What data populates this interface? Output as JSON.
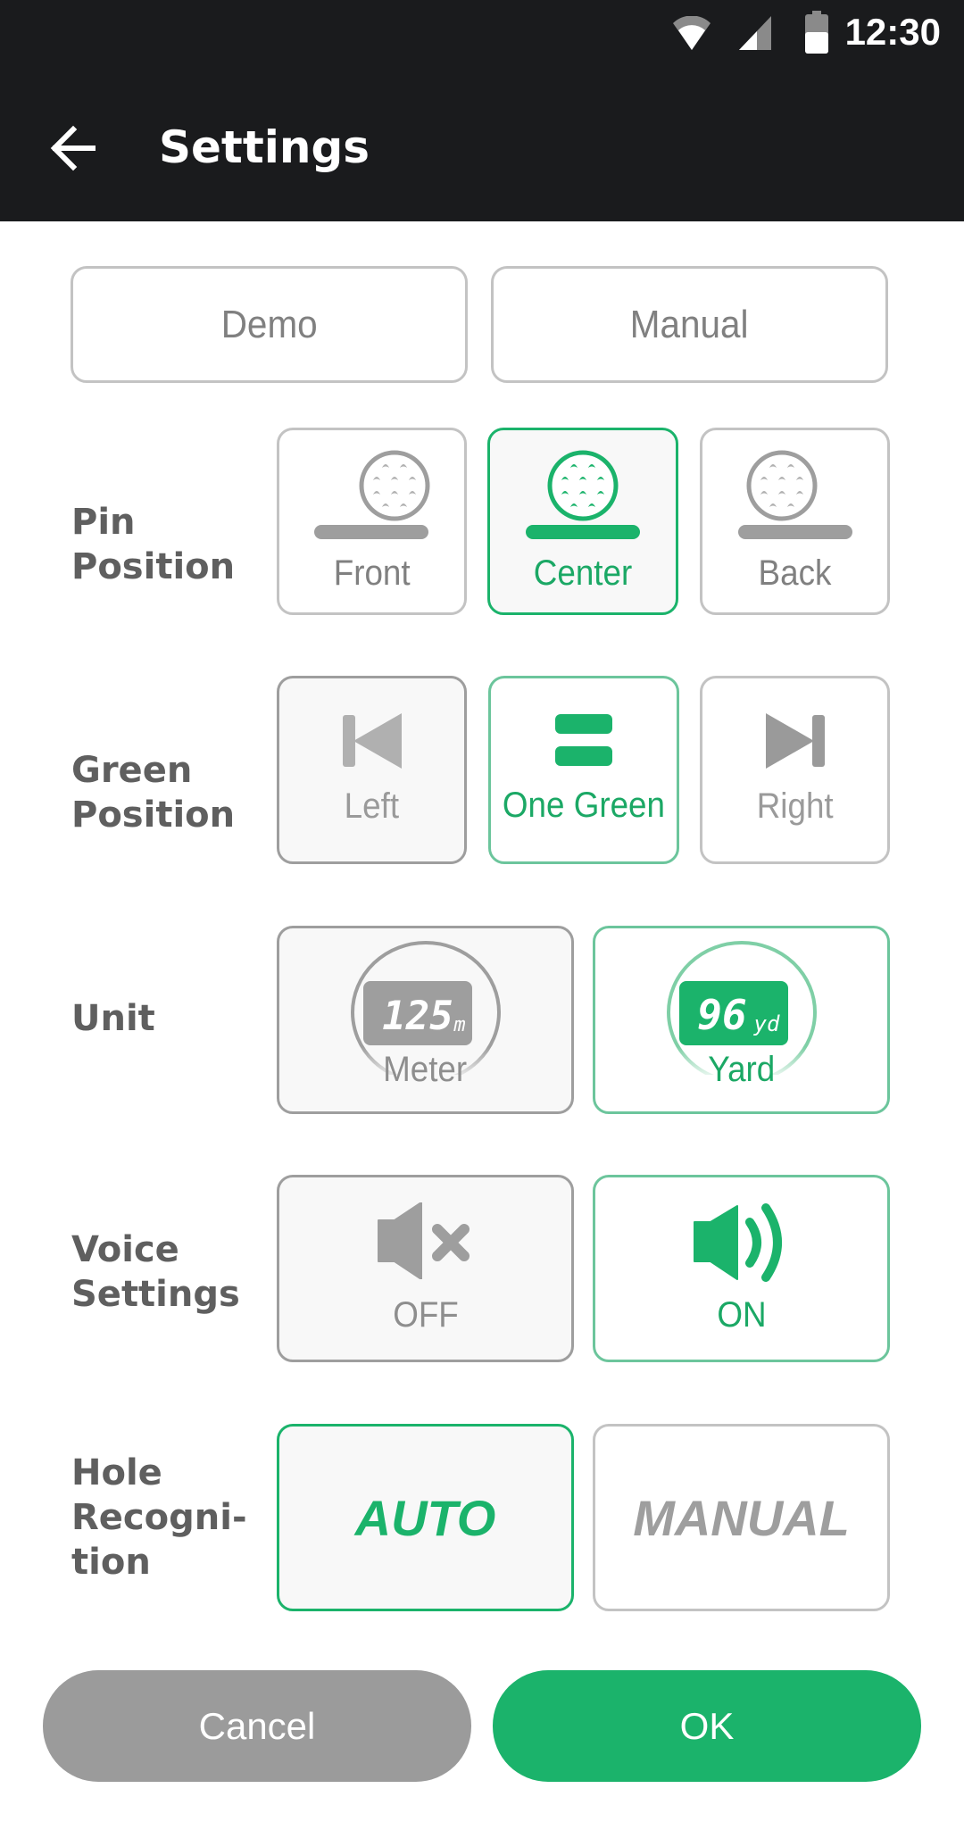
{
  "status_bar": {
    "time": "12:30",
    "icons": [
      "wifi-icon",
      "cellular-signal-icon",
      "battery-icon"
    ]
  },
  "app_bar": {
    "title": "Settings",
    "back_icon": "arrow-left-icon"
  },
  "mode": {
    "options": [
      {
        "label": "Demo",
        "selected": false
      },
      {
        "label": "Manual",
        "selected": false
      }
    ]
  },
  "pin_position": {
    "label": "Pin Position",
    "label_lines": [
      "Pin",
      "Position"
    ],
    "options": [
      {
        "label": "Front",
        "icon": "golf-ball-icon",
        "selected": false
      },
      {
        "label": "Center",
        "icon": "golf-ball-icon",
        "selected": true
      },
      {
        "label": "Back",
        "icon": "golf-ball-icon",
        "selected": false
      }
    ]
  },
  "green_position": {
    "label": "Green Position",
    "label_lines": [
      "Green",
      "Position"
    ],
    "options": [
      {
        "label": "Left",
        "icon": "skip-previous-icon",
        "selected": false
      },
      {
        "label": "One Green",
        "icon": "equals-icon",
        "selected": true
      },
      {
        "label": "Right",
        "icon": "skip-next-icon",
        "selected": false
      }
    ]
  },
  "unit": {
    "label": "Unit",
    "options": [
      {
        "label": "Meter",
        "display": "125",
        "unit_suffix": "m",
        "icon": "lcd-display-icon",
        "selected": false
      },
      {
        "label": "Yard",
        "display": "96",
        "unit_suffix": "yd",
        "icon": "lcd-display-icon",
        "selected": true
      }
    ]
  },
  "voice": {
    "label": "Voice Settings",
    "label_lines": [
      "Voice",
      "Settings"
    ],
    "options": [
      {
        "label": "OFF",
        "icon": "speaker-mute-icon",
        "selected": false
      },
      {
        "label": "ON",
        "icon": "speaker-on-icon",
        "selected": true
      }
    ]
  },
  "hole_recognition": {
    "label": "Hole Recognition",
    "label_lines": [
      "Hole",
      "Recogni-",
      "tion"
    ],
    "options": [
      {
        "label": "AUTO",
        "selected": true
      },
      {
        "label": "MANUAL",
        "selected": false
      }
    ]
  },
  "actions": {
    "cancel_label": "Cancel",
    "ok_label": "OK"
  },
  "colors": {
    "accent": "#1bb36b",
    "inactive": "#9e9e9e",
    "appbar": "#1a1b1d"
  }
}
